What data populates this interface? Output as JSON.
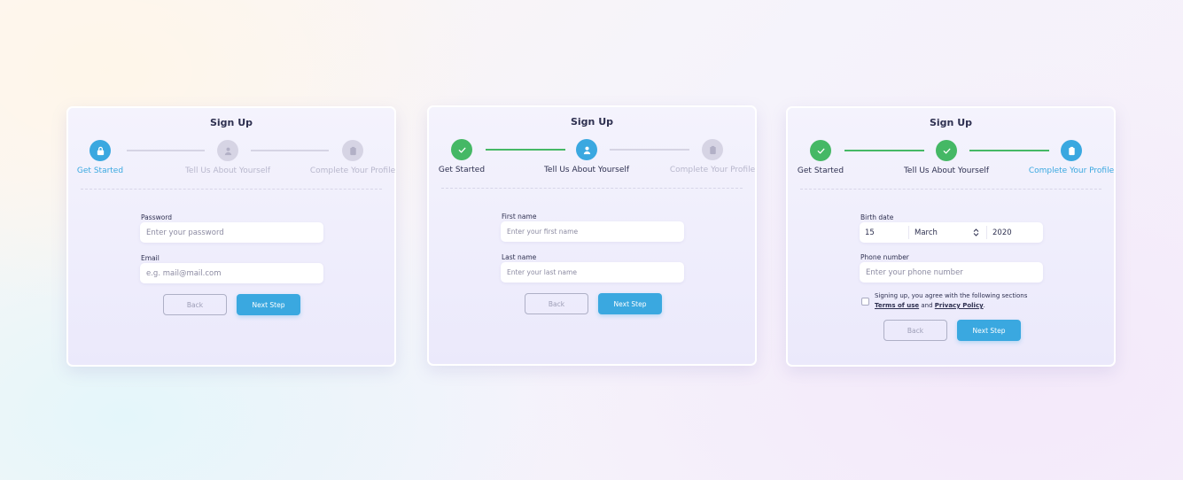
{
  "cards": [
    {
      "title": "Sign Up",
      "steps": [
        {
          "label": "Get Started",
          "state": "active",
          "icon": "lock-icon"
        },
        {
          "label": "Tell Us About Yourself",
          "state": "todo",
          "icon": "user-icon"
        },
        {
          "label": "Complete Your Profile",
          "state": "todo",
          "icon": "clipboard-icon"
        }
      ],
      "fields": [
        {
          "label": "Password",
          "placeholder": "Enter your password"
        },
        {
          "label": "Email",
          "placeholder": "e.g. mail@mail.com"
        }
      ],
      "back_label": "Back",
      "next_label": "Next Step"
    },
    {
      "title": "Sign Up",
      "steps": [
        {
          "label": "Get Started",
          "state": "done",
          "icon": "check-icon"
        },
        {
          "label": "Tell Us About Yourself",
          "state": "active",
          "icon": "user-icon"
        },
        {
          "label": "Complete Your Profile",
          "state": "todo",
          "icon": "clipboard-icon"
        }
      ],
      "fields": [
        {
          "label": "First name",
          "placeholder": "Enter your first name"
        },
        {
          "label": "Last name",
          "placeholder": "Enter your last name"
        }
      ],
      "back_label": "Back",
      "next_label": "Next Step"
    },
    {
      "title": "Sign Up",
      "steps": [
        {
          "label": "Get Started",
          "state": "done",
          "icon": "check-icon"
        },
        {
          "label": "Tell Us About Yourself",
          "state": "done",
          "icon": "check-icon"
        },
        {
          "label": "Complete Your Profile",
          "state": "active",
          "icon": "clipboard-icon"
        }
      ],
      "birth_date": {
        "label": "Birth date",
        "day": "15",
        "month": "March",
        "year": "2020"
      },
      "phone": {
        "label": "Phone number",
        "placeholder": "Enter your phone number"
      },
      "terms": {
        "text": "Signing up, you agree with the following sections",
        "terms_link": "Terms of use",
        "and": "and",
        "privacy_link": "Privacy Policy",
        "end": "."
      },
      "back_label": "Back",
      "next_label": "Next Step"
    }
  ],
  "colors": {
    "accent": "#3aa8e0",
    "success": "#45b865",
    "inactive": "#d6d4e4",
    "text": "#2e3050"
  }
}
